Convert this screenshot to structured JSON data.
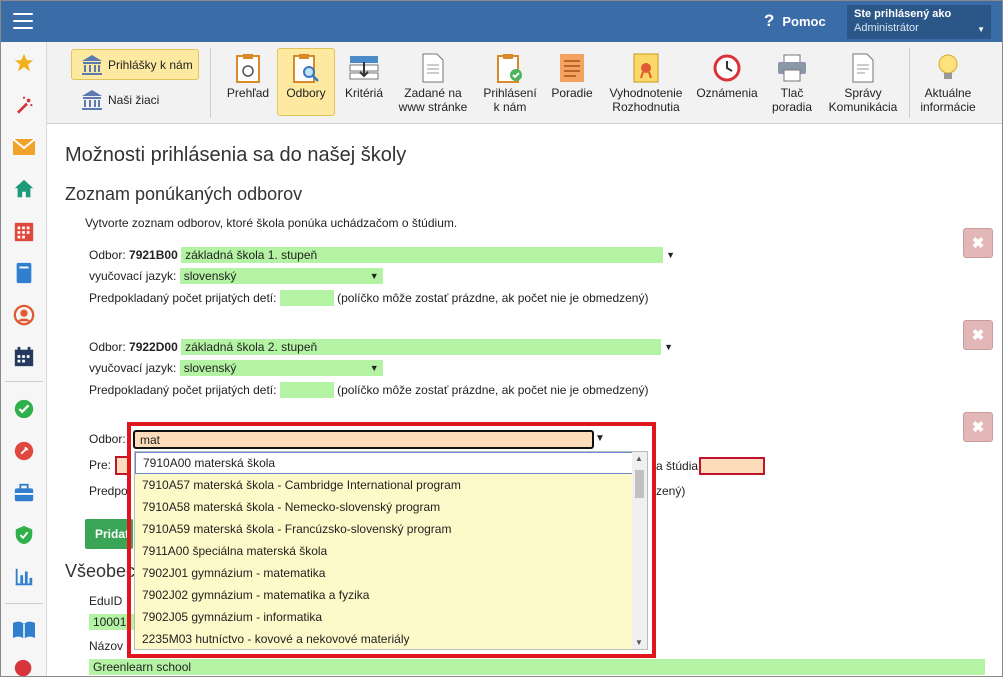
{
  "topbar": {
    "help_label": "Pomoc",
    "user_line1": "Ste prihlásený ako",
    "user_line2": "Administrátor"
  },
  "sidebar": {
    "items": [
      "star-icon",
      "magic-wand-icon",
      "mail-icon",
      "home-icon",
      "calendar-grid-icon",
      "book-icon",
      "user-circle-icon",
      "calendar-icon",
      "check-circle-icon",
      "pin-badge-icon",
      "briefcase-icon",
      "shield-check-icon",
      "bar-chart-icon",
      "open-book-icon",
      "speech-icon"
    ]
  },
  "toolbar": {
    "left_buttons": [
      {
        "label": "Prihlášky k nám",
        "active": true
      },
      {
        "label": "Naši žiaci",
        "active": false
      }
    ],
    "buttons": [
      {
        "label": "Prehľad",
        "active": false
      },
      {
        "label": "Odbory",
        "active": true
      },
      {
        "label": "Kritériá",
        "active": false
      },
      {
        "label": "Zadané na\nwww stránke",
        "active": false
      },
      {
        "label": "Prihlásení\nk nám",
        "active": false
      },
      {
        "label": "Poradie",
        "active": false
      },
      {
        "label": "Vyhodnotenie\nRozhodnutia",
        "active": false
      },
      {
        "label": "Oznámenia",
        "active": false
      },
      {
        "label": "Tlač\nporadia",
        "active": false
      },
      {
        "label": "Správy\nKomunikácia",
        "active": false
      },
      {
        "label": "Aktuálne\ninformácie",
        "active": false
      }
    ]
  },
  "page": {
    "title": "Možnosti prihlásenia sa do našej školy",
    "section_title": "Zoznam ponúkaných odborov",
    "intro": "Vytvorte zoznam odborov, ktoré škola ponúka uchádzačom o štúdium."
  },
  "labels": {
    "odbor": "Odbor:",
    "jazyk": "vyučovací jazyk:",
    "pocet": "Predpokladaný počet prijatých detí:",
    "pocet_note": "(políčko môže zostať prázdne, ak počet nie je obmedzený)",
    "pre": "Pre:",
    "forma_studia": "a štúdia:",
    "predpo": "Predpo",
    "zeny": "zený)",
    "add_button": "Pridať",
    "vseobecne": "Všeobec",
    "eduid": "EduID",
    "eduid_value": "10001",
    "nazov": "Názov",
    "school_name": "Greenlearn school",
    "delete": "✖"
  },
  "odbory": [
    {
      "code": "7921B00",
      "name": "základná škola 1. stupeň",
      "language": "slovenský",
      "count": ""
    },
    {
      "code": "7922D00",
      "name": "základná škola 2. stupeň",
      "language": "slovenský",
      "count": ""
    }
  ],
  "autocomplete": {
    "query": "mat",
    "options": [
      "7910A00 materská škola",
      "7910A57 materská škola - Cambridge International program",
      "7910A58 materská škola - Nemecko-slovenský program",
      "7910A59 materská škola - Francúzsko-slovenský program",
      "7911A00 špeciálna materská škola",
      "7902J01 gymnázium - matematika",
      "7902J02 gymnázium - matematika a fyzika",
      "7902J05 gymnázium - informatika",
      "2235M03 hutníctvo - kovové a nekovové materiály"
    ]
  },
  "colors": {
    "topbar": "#3a6ca8",
    "green_field": "#b4f3a4",
    "highlight": "#e0161e",
    "dropdown_bg": "#fdf9c8",
    "input_bg": "#fcdcba"
  }
}
